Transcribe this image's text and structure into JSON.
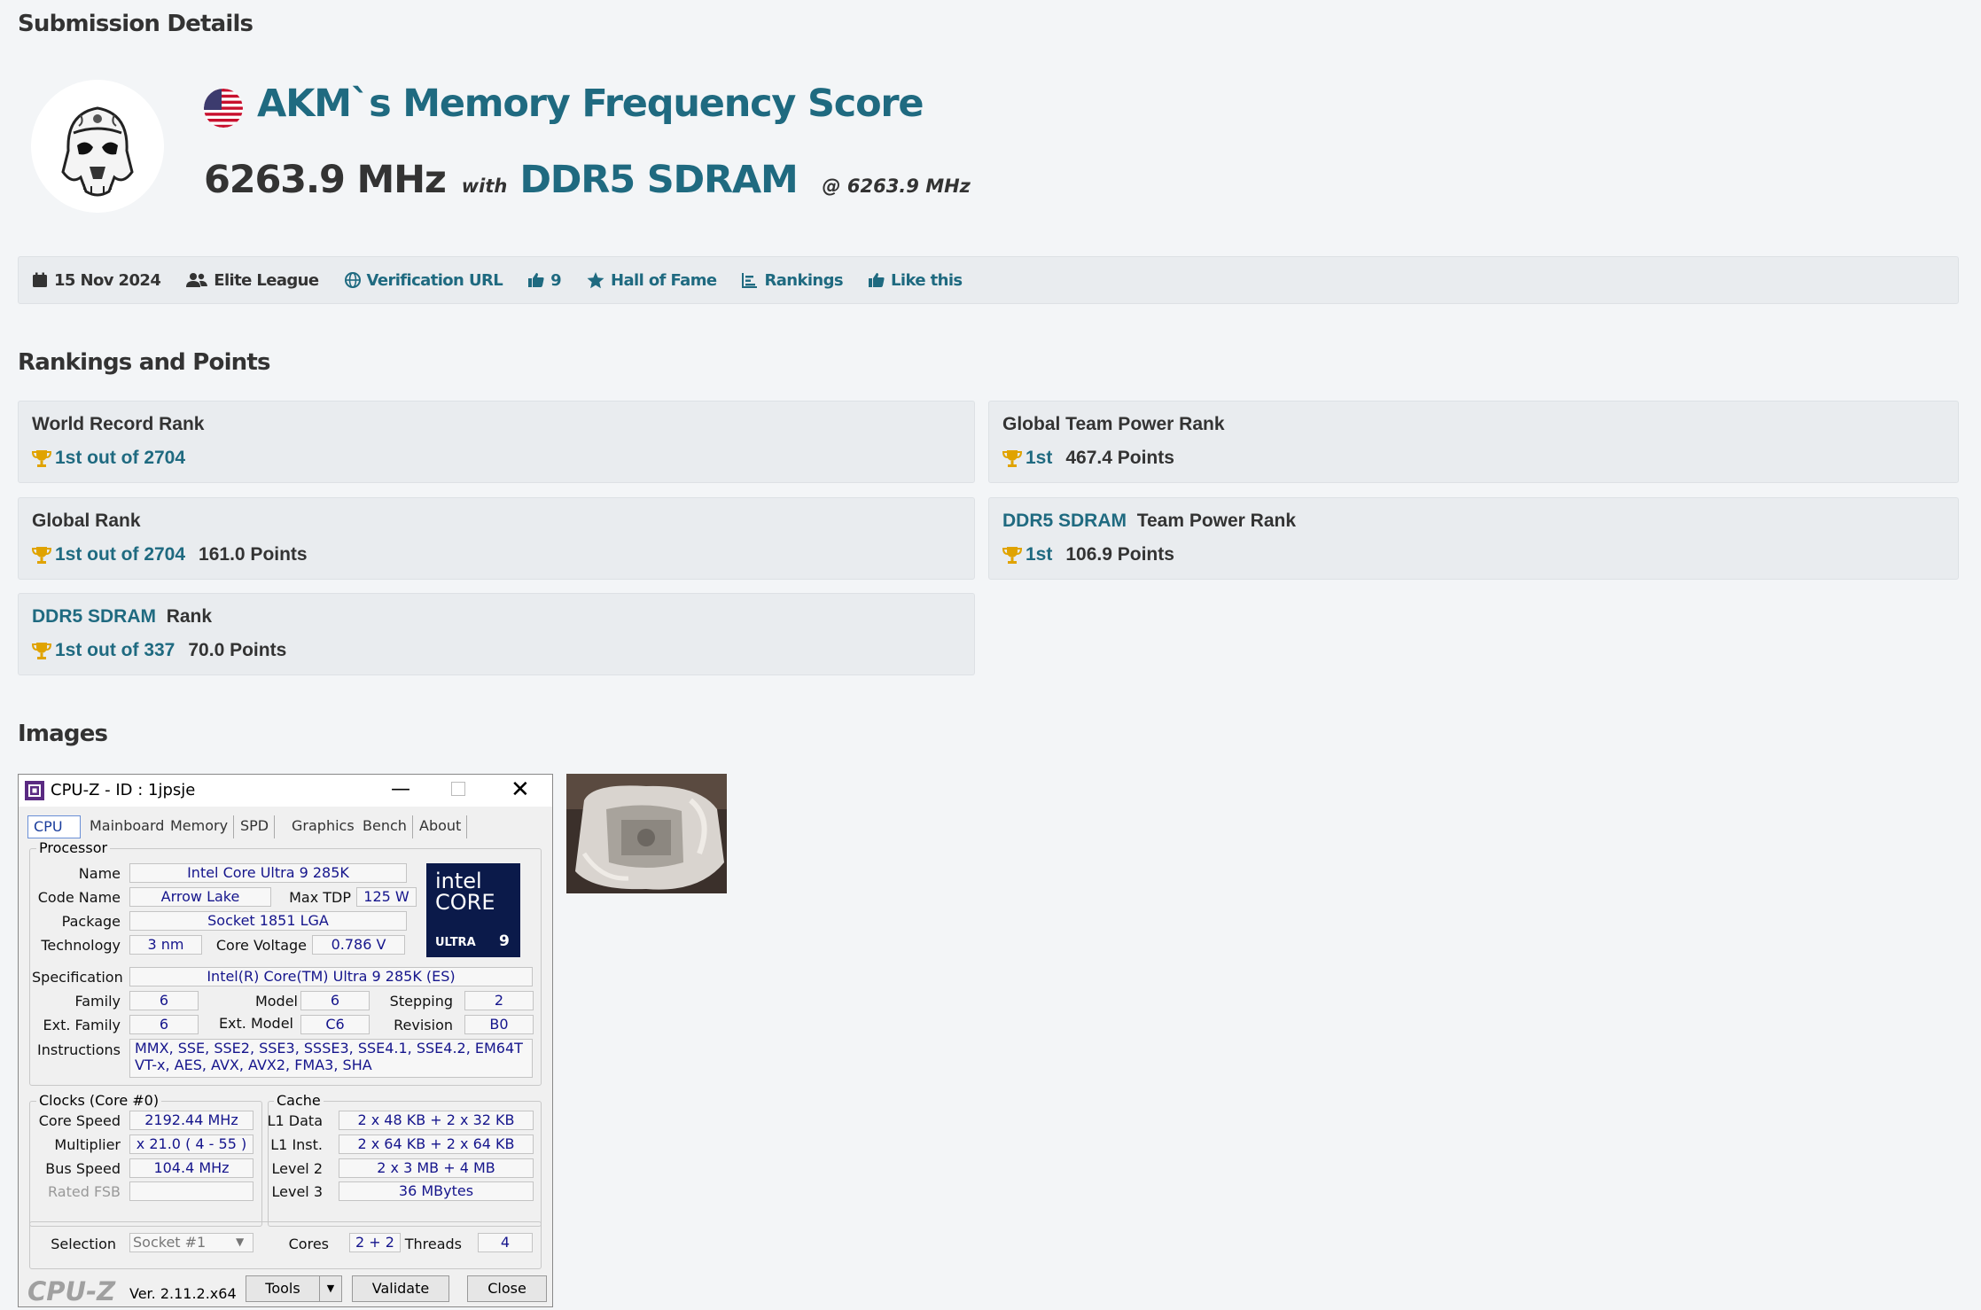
{
  "page": {
    "section_title": "Submission Details",
    "title": "AKM`s Memory Frequency Score",
    "score": {
      "value": "6263.9 MHz",
      "with": "with",
      "memory": "DDR5 SDRAM",
      "at": "@ 6263.9 MHz"
    }
  },
  "infobar": {
    "date": "15 Nov 2024",
    "league": "Elite League",
    "verification": "Verification URL",
    "likes_count": "9",
    "hall_of_fame": "Hall of Fame",
    "rankings": "Rankings",
    "like_this": "Like this"
  },
  "rankings": {
    "section_title": "Rankings and Points",
    "world_record": {
      "title": "World Record Rank",
      "rank": "1st out of 2704"
    },
    "global_team": {
      "title": "Global Team Power Rank",
      "rank": "1st",
      "points": "467.4 Points"
    },
    "global": {
      "title": "Global Rank",
      "rank": "1st out of 2704",
      "points": "161.0 Points"
    },
    "ddr5_team": {
      "title_link": "DDR5 SDRAM",
      "title_rest": "Team Power Rank",
      "rank": "1st",
      "points": "106.9 Points"
    },
    "ddr5": {
      "title_link": "DDR5 SDRAM",
      "title_rest": "Rank",
      "rank": "1st out of 337",
      "points": "70.0 Points"
    }
  },
  "images": {
    "section_title": "Images",
    "cpuz": {
      "title": "CPU-Z   - ID : 1jpsje",
      "tabs": [
        "CPU",
        "Mainboard",
        "Memory",
        "SPD",
        "Graphics",
        "Bench",
        "About"
      ],
      "processor_legend": "Processor",
      "name_label": "Name",
      "name": "Intel Core Ultra 9 285K",
      "codename_label": "Code Name",
      "codename": "Arrow Lake",
      "maxtdp_label": "Max TDP",
      "maxtdp": "125 W",
      "package_label": "Package",
      "package": "Socket 1851 LGA",
      "tech_label": "Technology",
      "tech": "3 nm",
      "corevolt_label": "Core Voltage",
      "corevolt": "0.786 V",
      "spec_label": "Specification",
      "spec": "Intel(R) Core(TM) Ultra 9 285K (ES)",
      "family_label": "Family",
      "family": "6",
      "model_label": "Model",
      "model": "6",
      "stepping_label": "Stepping",
      "stepping": "2",
      "extfamily_label": "Ext. Family",
      "extfamily": "6",
      "extmodel_label": "Ext. Model",
      "extmodel": "C6",
      "revision_label": "Revision",
      "revision": "B0",
      "instr_label": "Instructions",
      "instr_line1": "MMX, SSE, SSE2, SSE3, SSSE3, SSE4.1, SSE4.2, EM64T",
      "instr_line2": "VT-x, AES, AVX, AVX2, FMA3, SHA",
      "logo_l1": "intel",
      "logo_l2": "CORE",
      "logo_l3": "ULTRA",
      "logo_l4": "9",
      "clocks_legend": "Clocks (Core #0)",
      "corespeed_label": "Core Speed",
      "corespeed": "2192.44 MHz",
      "multiplier_label": "Multiplier",
      "multiplier": "x 21.0 ( 4 - 55 )",
      "busspeed_label": "Bus Speed",
      "busspeed": "104.4 MHz",
      "ratedfsb_label": "Rated FSB",
      "ratedfsb": "",
      "cache_legend": "Cache",
      "l1data_label": "L1 Data",
      "l1data": "2 x 48 KB + 2 x 32 KB",
      "l1inst_label": "L1 Inst.",
      "l1inst": "2 x 64 KB + 2 x 64 KB",
      "level2_label": "Level 2",
      "level2": "2 x 3 MB + 4 MB",
      "level3_label": "Level 3",
      "level3": "36 MBytes",
      "selection_label": "Selection",
      "selection": "Socket #1",
      "cores_label": "Cores",
      "cores": "2 + 2",
      "threads_label": "Threads",
      "threads": "4",
      "brand": "CPU-Z",
      "version": "Ver. 2.11.2.x64",
      "tools": "Tools",
      "validate": "Validate",
      "close": "Close"
    }
  },
  "colors": {
    "accent": "#1f6a80",
    "trophy": "#e0a300",
    "background": "#f3f5f7",
    "card": "#e9ecef"
  }
}
